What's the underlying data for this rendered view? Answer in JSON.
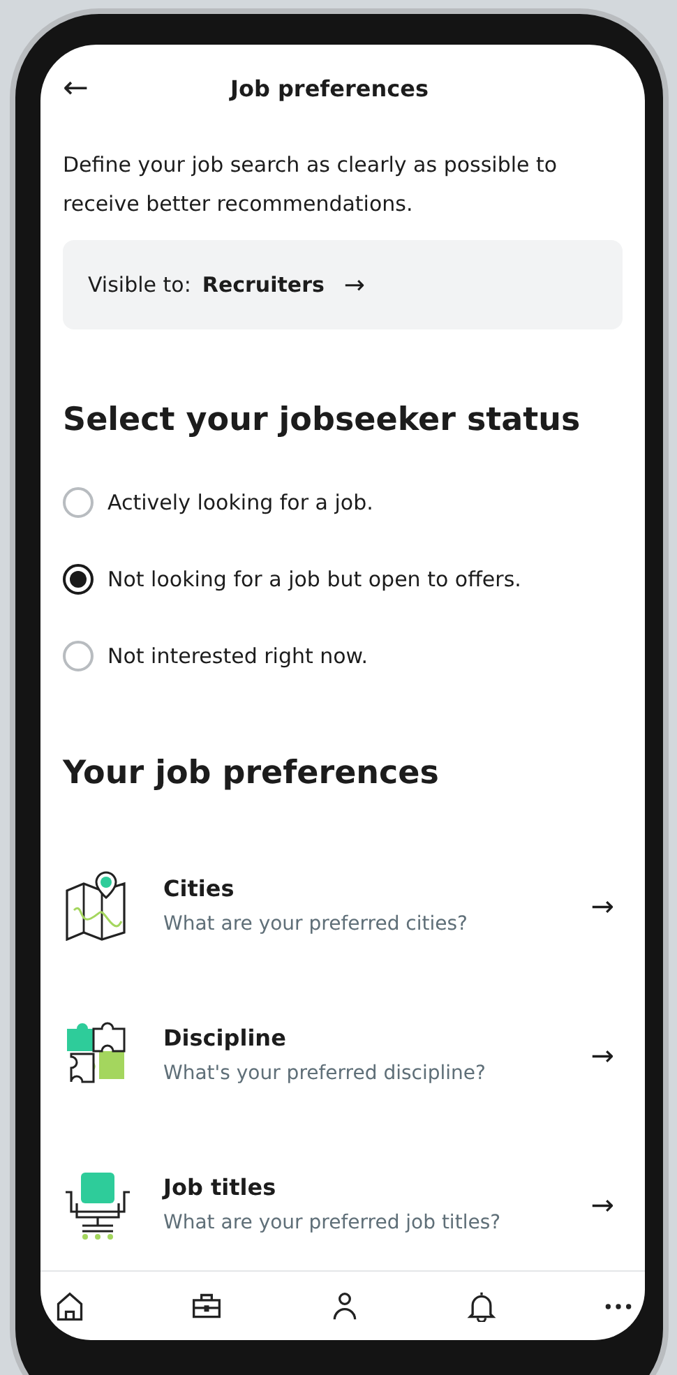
{
  "header": {
    "back": "←",
    "title": "Job preferences"
  },
  "intro": "Define your job search as clearly as possible to receive better recommendations.",
  "visibility": {
    "label": "Visible to:",
    "value": "Recruiters",
    "arrow": "→"
  },
  "status": {
    "heading": "Select your jobseeker status",
    "options": [
      {
        "label": "Actively looking for a job.",
        "selected": false
      },
      {
        "label": "Not looking for a job but open to offers.",
        "selected": true
      },
      {
        "label": "Not interested right now.",
        "selected": false
      }
    ]
  },
  "preferences": {
    "heading": "Your job preferences",
    "items": [
      {
        "kind": "map",
        "title": "Cities",
        "subtitle": "What are your preferred cities?",
        "arrow": "→"
      },
      {
        "kind": "puzzle",
        "title": "Discipline",
        "subtitle": "What's your preferred discipline?",
        "arrow": "→"
      },
      {
        "kind": "chair",
        "title": "Job titles",
        "subtitle": "What are your preferred job titles?",
        "arrow": "→"
      }
    ]
  },
  "nav": [
    {
      "kind": "home"
    },
    {
      "kind": "briefcase"
    },
    {
      "kind": "person"
    },
    {
      "kind": "bell"
    },
    {
      "kind": "more"
    }
  ]
}
